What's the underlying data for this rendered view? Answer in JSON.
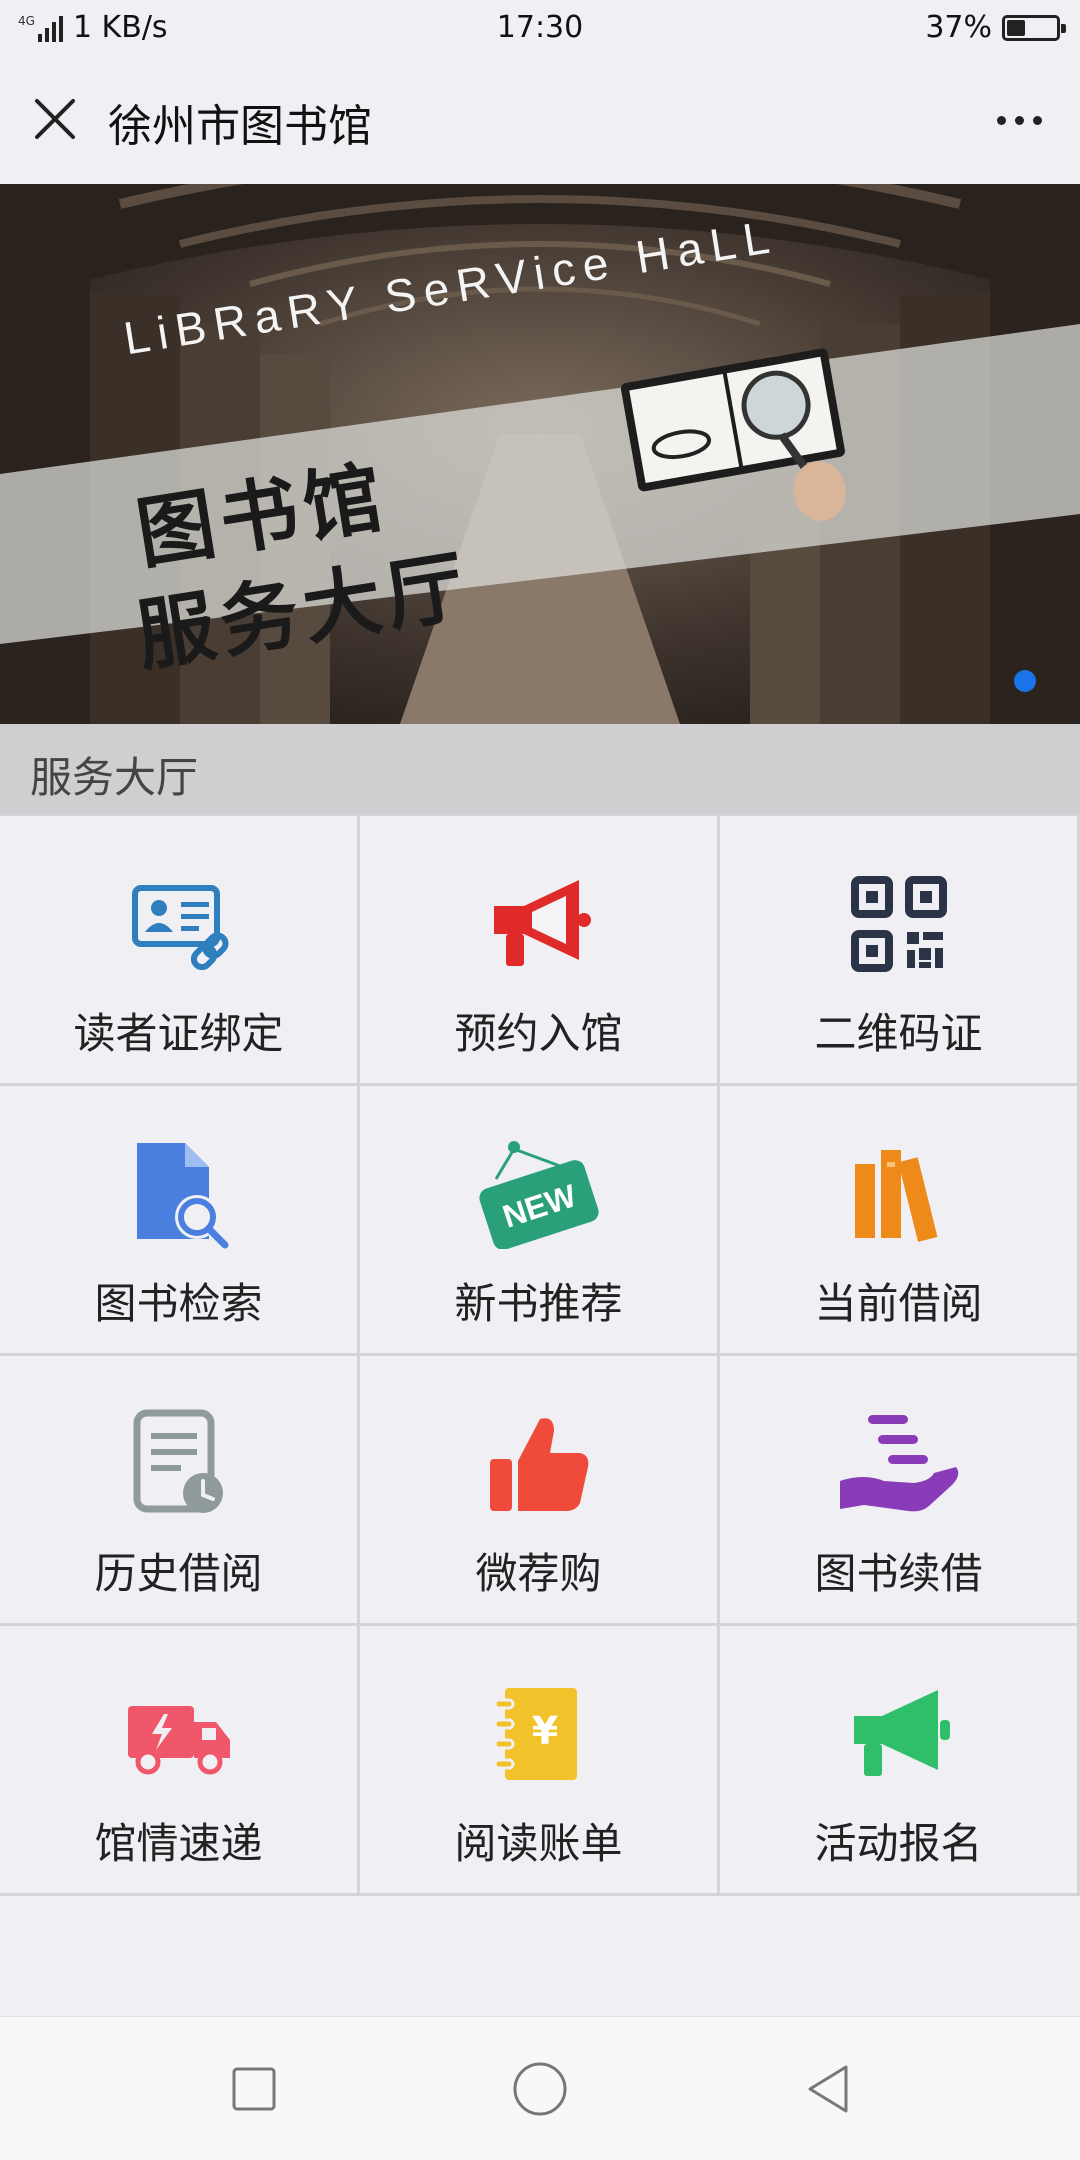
{
  "status": {
    "network": "4G",
    "speed": "1 KB/s",
    "time": "17:30",
    "battery": "37%",
    "battery_level": 0.37
  },
  "title_bar": {
    "title": "徐州市图书馆"
  },
  "banner": {
    "english_text": "LiBRaRY SeRVice HaLL",
    "line1": "图书馆",
    "line2": "服务大厅",
    "indicator_color": "#1a73e8"
  },
  "section": {
    "title": "服务大厅"
  },
  "services": [
    {
      "label": "读者证绑定",
      "icon": "reader-card-link-icon",
      "color": "#2f7fbf"
    },
    {
      "label": "预约入馆",
      "icon": "megaphone-icon",
      "color": "#e02a2a"
    },
    {
      "label": "二维码证",
      "icon": "qr-code-icon",
      "color": "#2b3446"
    },
    {
      "label": "图书检索",
      "icon": "document-search-icon",
      "color": "#4a7fe0"
    },
    {
      "label": "新书推荐",
      "icon": "new-sign-icon",
      "color": "#2aa07a"
    },
    {
      "label": "当前借阅",
      "icon": "books-icon",
      "color": "#ee8a1a"
    },
    {
      "label": "历史借阅",
      "icon": "history-document-icon",
      "color": "#8f9a9a"
    },
    {
      "label": "微荐购",
      "icon": "thumbs-up-icon",
      "color": "#ef4a3a"
    },
    {
      "label": "图书续借",
      "icon": "hand-give-icon",
      "color": "#8a3cb8"
    },
    {
      "label": "馆情速递",
      "icon": "delivery-truck-icon",
      "color": "#f0576a"
    },
    {
      "label": "阅读账单",
      "icon": "bill-notebook-icon",
      "color": "#f2c22a"
    },
    {
      "label": "活动报名",
      "icon": "activity-megaphone-icon",
      "color": "#2fbf6a"
    }
  ]
}
